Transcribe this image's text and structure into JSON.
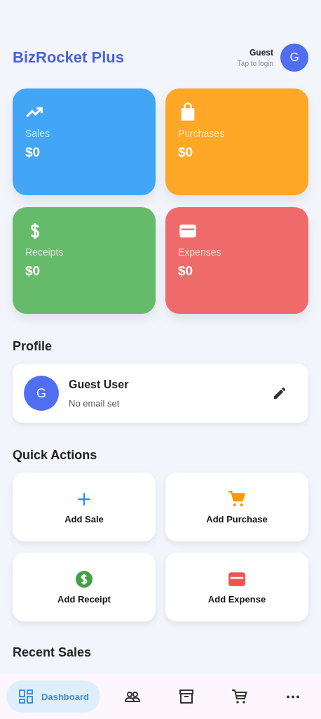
{
  "header": {
    "title": "BizRocket Plus",
    "user_name": "Guest",
    "user_hint": "Tap to login",
    "avatar_letter": "G"
  },
  "stats": [
    {
      "kind": "sales",
      "label": "Sales",
      "value": "$0",
      "color": "#42a5f5"
    },
    {
      "kind": "purchases",
      "label": "Purchases",
      "value": "$0",
      "color": "#ffa726"
    },
    {
      "kind": "receipts",
      "label": "Receipts",
      "value": "$0",
      "color": "#66bb6a"
    },
    {
      "kind": "expenses",
      "label": "Expenses",
      "value": "$0",
      "color": "#ef6b6b"
    }
  ],
  "profile": {
    "heading": "Profile",
    "avatar_letter": "G",
    "name": "Guest User",
    "email": "No email set"
  },
  "quick_actions": {
    "heading": "Quick Actions",
    "items": [
      {
        "kind": "sale",
        "label": "Add Sale"
      },
      {
        "kind": "purchase",
        "label": "Add Purchase"
      },
      {
        "kind": "receipt",
        "label": "Add Receipt"
      },
      {
        "kind": "expense",
        "label": "Add Expense"
      }
    ]
  },
  "recent_sales": {
    "heading": "Recent Sales"
  },
  "bottom_nav": [
    {
      "kind": "dashboard",
      "label": "Dashboard",
      "selected": true
    },
    {
      "kind": "people",
      "selected": false
    },
    {
      "kind": "inventory",
      "selected": false
    },
    {
      "kind": "cart",
      "selected": false
    },
    {
      "kind": "more",
      "selected": false
    }
  ]
}
